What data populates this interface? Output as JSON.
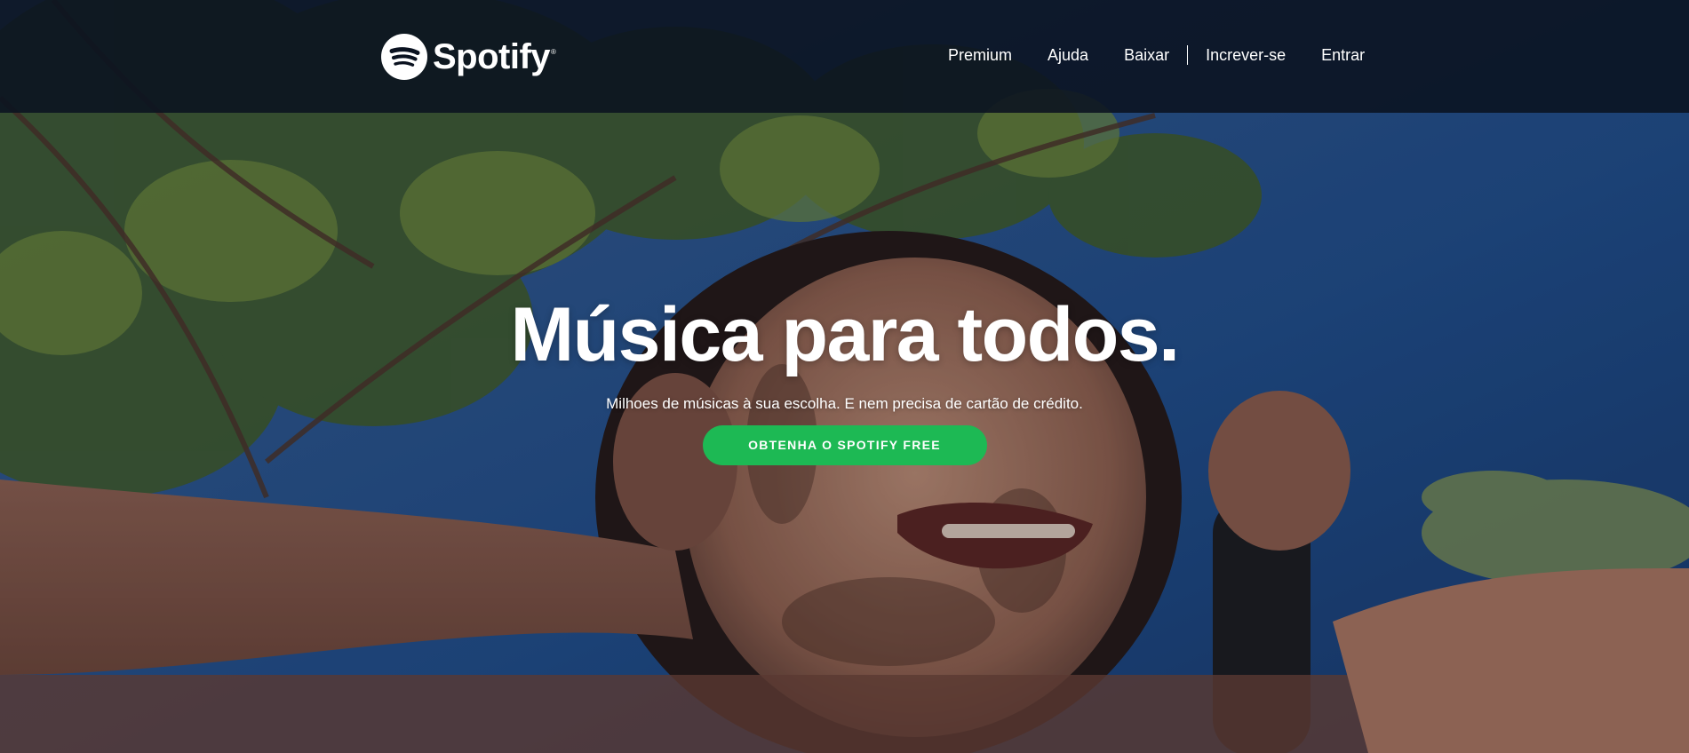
{
  "brand": {
    "name": "Spotify",
    "registered_mark": "®",
    "accent_color": "#1db954",
    "nav_background": "#0a1220"
  },
  "nav": {
    "items": [
      {
        "label": "Premium"
      },
      {
        "label": "Ajuda"
      },
      {
        "label": "Baixar"
      },
      {
        "label": "Increver-se"
      },
      {
        "label": "Entrar"
      }
    ]
  },
  "hero": {
    "title": "Música para todos.",
    "subtitle": "Milhoes de músicas à sua escolha. E nem precisa de cartão de crédito.",
    "cta_label": "OBTENHA O SPOTIFY FREE",
    "background_icon": "photo-girl-with-headphones-under-tree"
  }
}
